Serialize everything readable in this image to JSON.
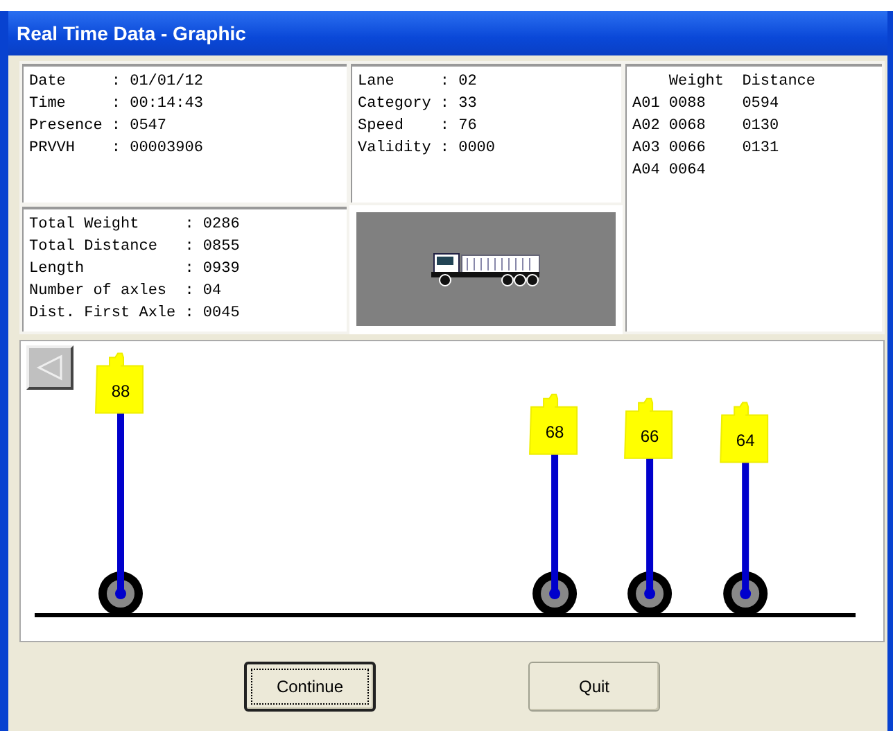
{
  "window": {
    "title": "Real Time Data - Graphic"
  },
  "info": [
    {
      "label": "Date",
      "value": ": 01/01/12"
    },
    {
      "label": "Time",
      "value": ": 00:14:43"
    },
    {
      "label": "Presence",
      "value": ": 0547"
    },
    {
      "label": "PRVVH",
      "value": ": 00003906"
    }
  ],
  "vehicle": [
    {
      "label": "Lane",
      "value": ": 02"
    },
    {
      "label": "Category",
      "value": ": 33"
    },
    {
      "label": "Speed",
      "value": ": 76"
    },
    {
      "label": "Validity",
      "value": ": 0000"
    }
  ],
  "totals": [
    {
      "label": "Total Weight",
      "value": ": 0286"
    },
    {
      "label": "Total Distance",
      "value": ": 0855"
    },
    {
      "label": "Length",
      "value": ": 0939"
    },
    {
      "label": "Number of axles",
      "value": ": 04"
    },
    {
      "label": "Dist. First Axle",
      "value": ": 0045"
    }
  ],
  "axle_table": {
    "columns": [
      "Weight",
      "Distance"
    ],
    "rows": [
      {
        "name": "A01",
        "weight": "0088",
        "distance": "0594"
      },
      {
        "name": "A02",
        "weight": "0068",
        "distance": "0130"
      },
      {
        "name": "A03",
        "weight": "0066",
        "distance": "0131"
      },
      {
        "name": "A04",
        "weight": "0064"
      }
    ]
  },
  "axle_labels": [
    "88",
    "68",
    "66",
    "64"
  ],
  "buttons": [
    {
      "label": "Continue",
      "focused": true
    },
    {
      "label": "Quit",
      "focused": false
    }
  ]
}
